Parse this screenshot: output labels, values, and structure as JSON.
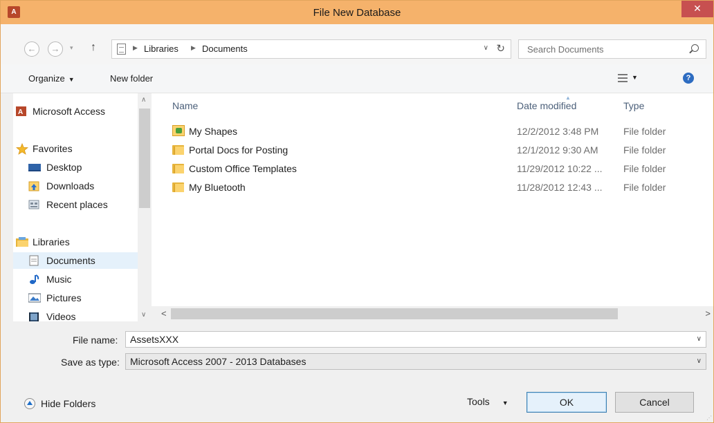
{
  "window": {
    "title": "File New Database",
    "app_icon": "A",
    "close_glyph": "✕"
  },
  "address": {
    "breadcrumbs": [
      "Libraries",
      "Documents"
    ],
    "search_placeholder": "Search Documents"
  },
  "toolbar": {
    "organize_label": "Organize",
    "new_folder_label": "New folder",
    "help_glyph": "?"
  },
  "nav": {
    "items": [
      {
        "label": "Microsoft Access",
        "icon": "access-icon",
        "level": "top"
      },
      {
        "label": "Favorites",
        "icon": "star-icon",
        "level": "top"
      },
      {
        "label": "Desktop",
        "icon": "desktop-icon",
        "level": "child"
      },
      {
        "label": "Downloads",
        "icon": "downloads-icon",
        "level": "child"
      },
      {
        "label": "Recent places",
        "icon": "recent-places-icon",
        "level": "child"
      },
      {
        "label": "Libraries",
        "icon": "libraries-icon",
        "level": "top"
      },
      {
        "label": "Documents",
        "icon": "documents-icon",
        "level": "child",
        "selected": true
      },
      {
        "label": "Music",
        "icon": "music-icon",
        "level": "child"
      },
      {
        "label": "Pictures",
        "icon": "pictures-icon",
        "level": "child"
      },
      {
        "label": "Videos",
        "icon": "videos-icon",
        "level": "child"
      }
    ]
  },
  "files": {
    "columns": [
      "Name",
      "Date modified",
      "Type"
    ],
    "rows": [
      {
        "name": "My Shapes",
        "date": "12/2/2012 3:48 PM",
        "type": "File folder",
        "icon": "shapes-folder-icon"
      },
      {
        "name": "Portal Docs for Posting",
        "date": "12/1/2012 9:30 AM",
        "type": "File folder",
        "icon": "folder-icon"
      },
      {
        "name": "Custom Office Templates",
        "date": "11/29/2012 10:22 ...",
        "type": "File folder",
        "icon": "folder-icon"
      },
      {
        "name": "My Bluetooth",
        "date": "11/28/2012 12:43 ...",
        "type": "File folder",
        "icon": "folder-icon"
      }
    ]
  },
  "form": {
    "file_name_label": "File name:",
    "file_name_value": "AssetsXXX",
    "save_type_label": "Save as type:",
    "save_type_value": "Microsoft Access 2007 - 2013 Databases"
  },
  "footer": {
    "hide_folders_label": "Hide Folders",
    "tools_label": "Tools",
    "ok_label": "OK",
    "cancel_label": "Cancel"
  },
  "colors": {
    "titlebar": "#f5b26b",
    "close": "#c75050",
    "selected_nav": "#e5f1fb"
  }
}
